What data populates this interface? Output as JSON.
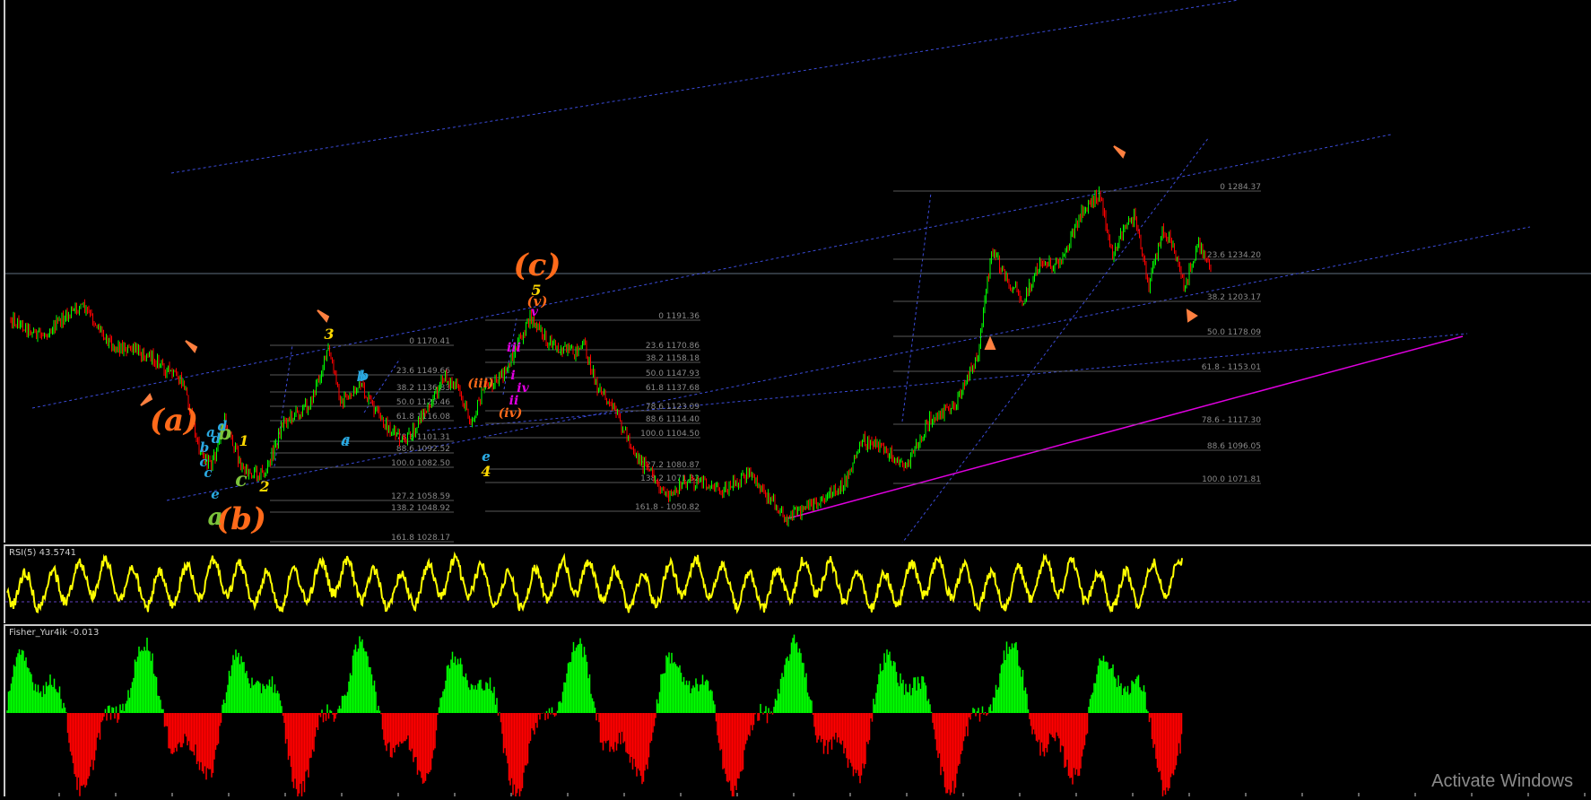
{
  "indicators": {
    "rsi_label": "RSI(5) 43.5741",
    "fisher_label": "Fisher_Yur4ik -0.013"
  },
  "watermark": "Activate Windows",
  "colors": {
    "background": "#000000",
    "price_up": "#00ff00",
    "price_down": "#ff0000",
    "channel": "#3b4bd8",
    "trendline": "#e000e0",
    "fib": "#6f6f6f",
    "rsi": "#ffff00",
    "fisher_pos": "#00ff00",
    "fisher_neg": "#ff0000",
    "arrow": "#ff8040"
  },
  "chart_data": [
    {
      "type": "line",
      "title": "",
      "fib_levels_1": [
        {
          "label": "0 1170.41"
        },
        {
          "label": "23.6 1149.66"
        },
        {
          "label": "38.2 1136.83"
        },
        {
          "label": "50.0 1126.46"
        },
        {
          "label": "61.8 1116.08"
        },
        {
          "label": "78.6 1101.31"
        },
        {
          "label": "88.6 1092.52"
        },
        {
          "label": "100.0 1082.50"
        },
        {
          "label": "127.2 1058.59"
        },
        {
          "label": "138.2 1048.92"
        },
        {
          "label": "161.8 1028.17"
        }
      ],
      "fib_levels_2": [
        {
          "label": "0 1191.36"
        },
        {
          "label": "23.6 1170.86"
        },
        {
          "label": "38.2 1158.18"
        },
        {
          "label": "50.0 1147.93"
        },
        {
          "label": "61.8 1137.68"
        },
        {
          "label": "78.6 1123.09"
        },
        {
          "label": "88.6 1114.40"
        },
        {
          "label": "100.0 1104.50"
        },
        {
          "label": "127.2 1080.87"
        },
        {
          "label": "138.2 1071.32"
        },
        {
          "label": "161.8 - 1050.82"
        }
      ],
      "fib_levels_3": [
        {
          "label": "0 1284.37"
        },
        {
          "label": "23.6 1234.20"
        },
        {
          "label": "38.2 1203.17"
        },
        {
          "label": "50.0 1178.09"
        },
        {
          "label": "61.8 - 1153.01"
        },
        {
          "label": "78.6 - 1117.30"
        },
        {
          "label": "88.6 1096.05"
        },
        {
          "label": "100.0 1071.81"
        }
      ],
      "wave_labels": [
        {
          "text": "(a)",
          "color": "#ff6a1a"
        },
        {
          "text": "(b)",
          "color": "#ff6a1a"
        },
        {
          "text": "(c)",
          "color": "#ff6a1a"
        },
        {
          "text": "a",
          "color": "#7cc23a"
        },
        {
          "text": "b",
          "color": "#7cc23a"
        },
        {
          "text": "c",
          "color": "#7cc23a"
        },
        {
          "text": "1",
          "color": "#ffd800"
        },
        {
          "text": "2",
          "color": "#ffd800"
        },
        {
          "text": "3",
          "color": "#ffd800"
        },
        {
          "text": "4",
          "color": "#ffd800"
        },
        {
          "text": "5",
          "color": "#ffd800"
        },
        {
          "text": "a",
          "color": "#2aa8e0"
        },
        {
          "text": "b",
          "color": "#2aa8e0"
        },
        {
          "text": "c",
          "color": "#2aa8e0"
        },
        {
          "text": "d",
          "color": "#2aa8e0"
        },
        {
          "text": "e",
          "color": "#2aa8e0"
        },
        {
          "text": "a",
          "color": "#2aa8e0"
        },
        {
          "text": "b",
          "color": "#2aa8e0"
        },
        {
          "text": "c",
          "color": "#2aa8e0"
        },
        {
          "text": "d",
          "color": "#2aa8e0"
        },
        {
          "text": "e",
          "color": "#2aa8e0"
        },
        {
          "text": "a",
          "color": "#2aa8e0"
        },
        {
          "text": "b",
          "color": "#2aa8e0"
        },
        {
          "text": "e",
          "color": "#2aa8e0"
        },
        {
          "text": "(iii)",
          "color": "#ff6a1a"
        },
        {
          "text": "(iv)",
          "color": "#ff6a1a"
        },
        {
          "text": "(v)",
          "color": "#ff6a1a"
        },
        {
          "text": "i",
          "color": "#e000e0"
        },
        {
          "text": "ii",
          "color": "#e000e0"
        },
        {
          "text": "iii",
          "color": "#e000e0"
        },
        {
          "text": "iv",
          "color": "#e000e0"
        },
        {
          "text": "v",
          "color": "#e000e0"
        }
      ]
    },
    {
      "type": "line",
      "title": "RSI(5) 43.5741",
      "series": [
        {
          "name": "RSI(5)",
          "last": 43.5741
        }
      ]
    },
    {
      "type": "bar",
      "title": "Fisher_Yur4ik -0.013",
      "series": [
        {
          "name": "Fisher_Yur4ik",
          "last": -0.013
        }
      ]
    }
  ]
}
